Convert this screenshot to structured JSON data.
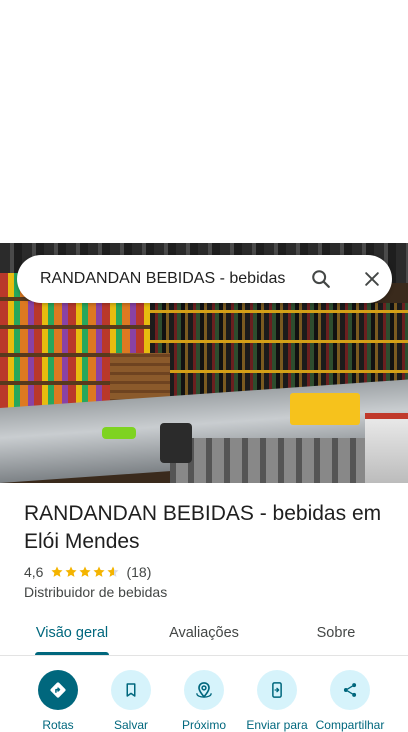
{
  "search": {
    "query": "RANDANDAN BEBIDAS - bebidas em Elói Mendes"
  },
  "place": {
    "name": "RANDANDAN BEBIDAS - bebidas em Elói Mendes",
    "rating": "4,6",
    "rating_value": 4.6,
    "review_count": "(18)",
    "category": "Distribuidor de bebidas"
  },
  "tabs": [
    {
      "label": "Visão geral",
      "active": true
    },
    {
      "label": "Avaliações",
      "active": false
    },
    {
      "label": "Sobre",
      "active": false
    }
  ],
  "actions": [
    {
      "label": "Rotas",
      "icon": "directions-icon"
    },
    {
      "label": "Salvar",
      "icon": "bookmark-icon"
    },
    {
      "label": "Próximo",
      "icon": "nearby-icon"
    },
    {
      "label": "Enviar para",
      "icon": "send-to-phone-icon"
    },
    {
      "label": "Compartilhar",
      "icon": "share-icon"
    }
  ],
  "colors": {
    "accent": "#00677d",
    "action_bg": "#d6f3fb",
    "star": "#f4b400"
  }
}
